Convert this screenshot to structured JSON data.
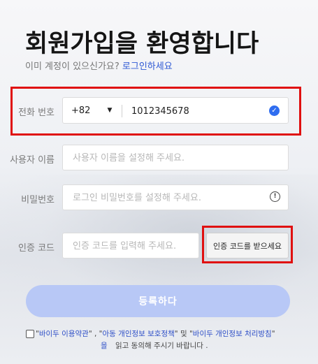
{
  "header": {
    "title": "회원가입을 환영합니다",
    "subtitle_prefix": "이미 계정이 있으신가요?",
    "login_link": "로그인하세요"
  },
  "form": {
    "phone": {
      "label": "전화 번호",
      "country_code": "+82",
      "value": "1012345678"
    },
    "username": {
      "label": "사용자 이름",
      "placeholder": "사용자 이름을 설정해 주세요."
    },
    "password": {
      "label": "비밀번호",
      "placeholder": "로그인 비밀번호를 설정해 주세요."
    },
    "verification": {
      "label": "인증 코드",
      "placeholder": "인증 코드를 입력해 주세요.",
      "button_label": "인증 코드를 받으세요"
    },
    "submit_label": "등록하다"
  },
  "agreement": {
    "quote_open": "\"",
    "terms_link": "바이두 이용약관",
    "sep1": "\" , \"",
    "child_link": "아동 개인정보 보호정책",
    "sep2": "\" 및 \"",
    "privacy_link": "바이두 개인정보 처리방침",
    "quote_close": "\"",
    "tail_eul": "을",
    "tail_rest": "읽고 동의해 주시기 바랍니다 ."
  },
  "colors": {
    "accent": "#2e58d4",
    "submit_bg": "#b8c8f6",
    "highlight": "#e01010"
  }
}
